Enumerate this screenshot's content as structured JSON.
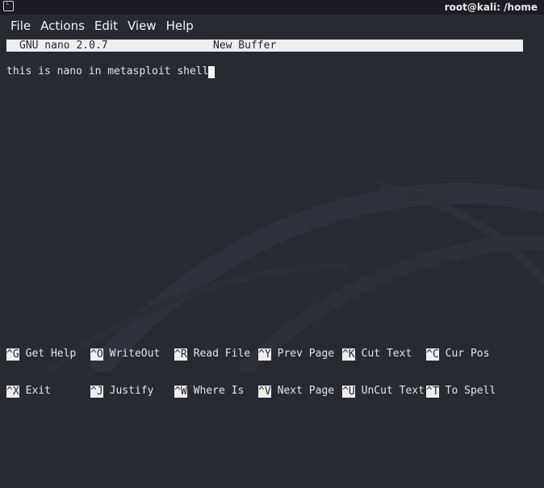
{
  "window": {
    "title": "root@kali: /home",
    "icon": "terminal-icon",
    "icon_glyph": "˪"
  },
  "menubar": {
    "items": [
      "File",
      "Actions",
      "Edit",
      "View",
      "Help"
    ]
  },
  "nano": {
    "version": "GNU nano 2.0.7",
    "buffer": "New Buffer",
    "content": "this is nano in metasploit shell"
  },
  "shortcuts": {
    "row1": [
      {
        "key": "^G",
        "label": "Get Help"
      },
      {
        "key": "^O",
        "label": "WriteOut"
      },
      {
        "key": "^R",
        "label": "Read File"
      },
      {
        "key": "^Y",
        "label": "Prev Page"
      },
      {
        "key": "^K",
        "label": "Cut Text"
      },
      {
        "key": "^C",
        "label": "Cur Pos"
      }
    ],
    "row2": [
      {
        "key": "^X",
        "label": "Exit"
      },
      {
        "key": "^J",
        "label": "Justify"
      },
      {
        "key": "^W",
        "label": "Where Is"
      },
      {
        "key": "^V",
        "label": "Next Page"
      },
      {
        "key": "^U",
        "label": "UnCut Text"
      },
      {
        "key": "^T",
        "label": "To Spell"
      }
    ]
  },
  "colors": {
    "background": "#262a33",
    "titlebar": "#1b1d23",
    "highlight": "#eceeef"
  }
}
